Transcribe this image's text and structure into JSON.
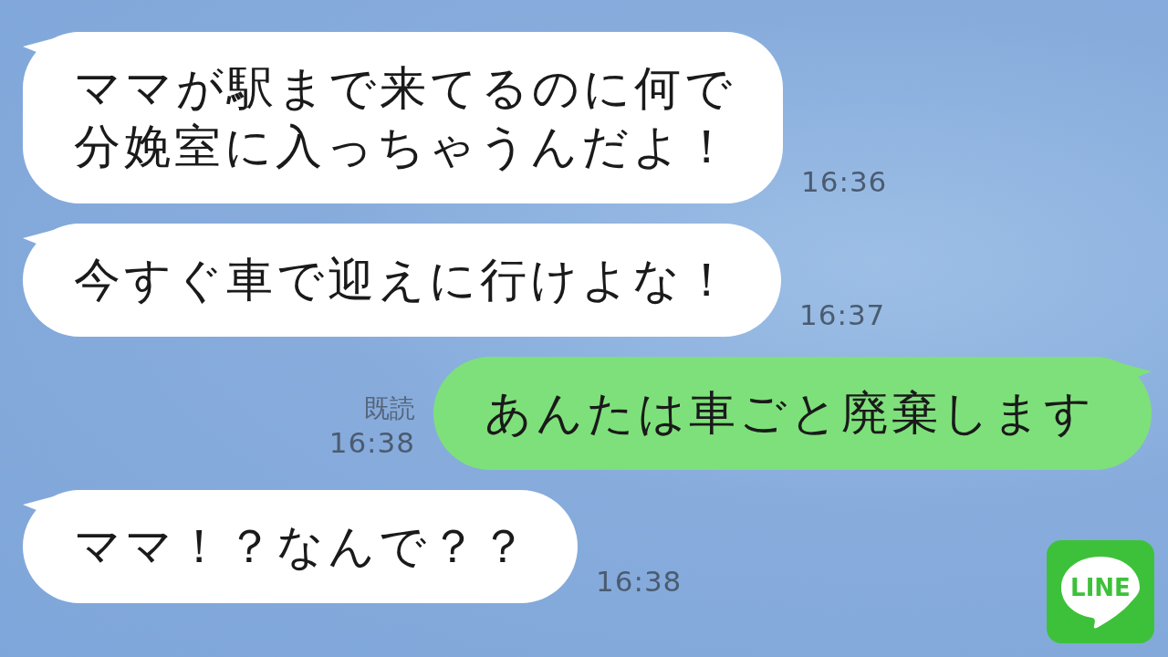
{
  "messages": [
    {
      "kind": "incoming",
      "lines": [
        "ママが駅まで来てるのに何で",
        "分娩室に入っちゃうんだよ！"
      ],
      "time": "16:36"
    },
    {
      "kind": "incoming",
      "lines": [
        "今すぐ車で迎えに行けよな！"
      ],
      "time": "16:37"
    },
    {
      "kind": "outgoing",
      "lines": [
        "あんたは車ごと廃棄します"
      ],
      "time": "16:38",
      "read_label": "既読"
    },
    {
      "kind": "incoming",
      "lines": [
        "ママ！？なんで？？"
      ],
      "time": "16:38"
    }
  ],
  "logo": {
    "text": "LINE"
  }
}
